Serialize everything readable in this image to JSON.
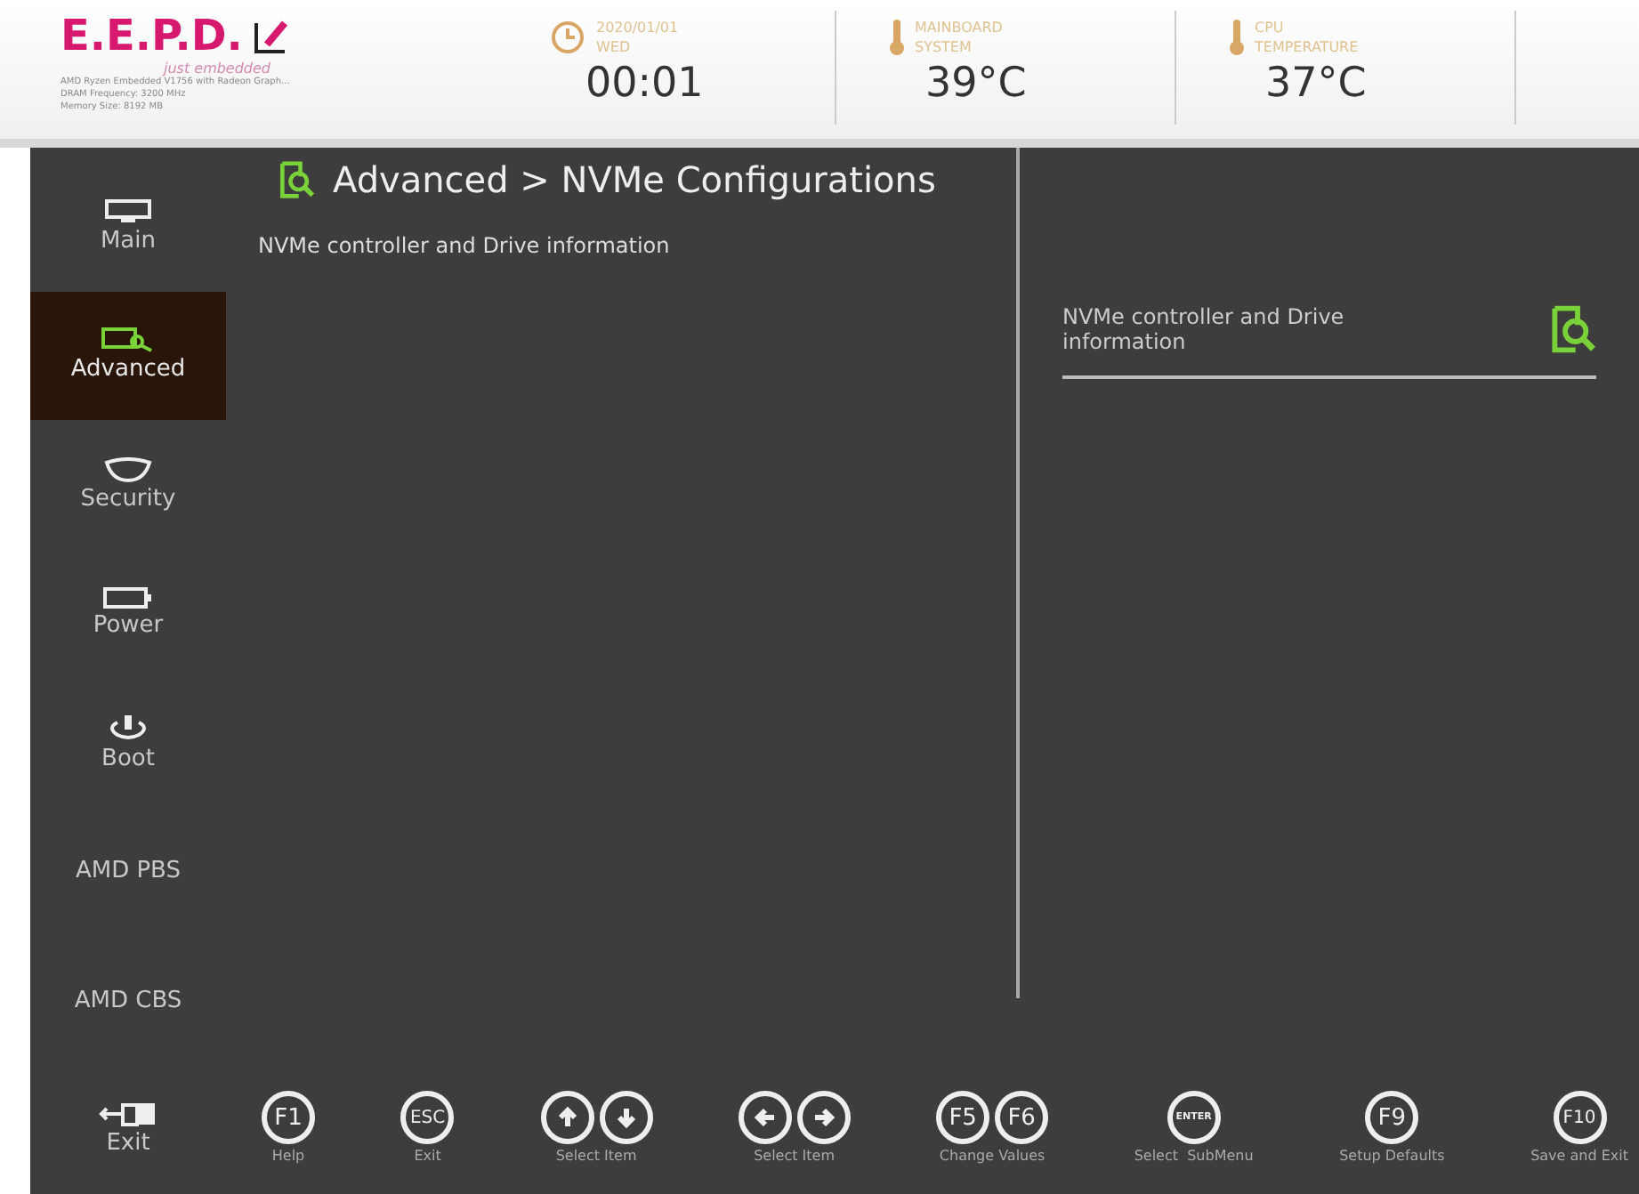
{
  "header": {
    "logo": "E.E.P.D.",
    "tagline": "just embedded",
    "system_info": [
      "AMD Ryzen Embedded V1756 with Radeon Graph...",
      "DRAM Frequency: 3200 MHz",
      "Memory Size: 8192 MB"
    ],
    "widgets": [
      {
        "kind": "clock",
        "caption": [
          "2020/01/01",
          "WED"
        ],
        "value": "00:01"
      },
      {
        "kind": "thermometer",
        "caption": [
          "MAINBOARD",
          "SYSTEM"
        ],
        "value": "39°C"
      },
      {
        "kind": "thermometer",
        "caption": [
          "CPU",
          "TEMPERATURE"
        ],
        "value": "37°C"
      }
    ]
  },
  "sidebar": {
    "items": [
      {
        "label": "Main",
        "kind": "monitor",
        "selected": false
      },
      {
        "label": "Advanced",
        "kind": "advanced",
        "selected": true
      },
      {
        "label": "Security",
        "kind": "shield",
        "selected": false
      },
      {
        "label": "Power",
        "kind": "battery",
        "selected": false
      },
      {
        "label": "Boot",
        "kind": "power",
        "selected": false
      },
      {
        "label": "AMD PBS",
        "kind": "none",
        "selected": false
      },
      {
        "label": "AMD CBS",
        "kind": "none",
        "selected": false
      },
      {
        "label": "Exit",
        "kind": "exit",
        "selected": false
      }
    ]
  },
  "breadcrumb": "Advanced > NVMe Configurations",
  "items": [
    "NVMe controller and Drive information"
  ],
  "help": {
    "text": "NVMe controller and Drive information"
  },
  "footer": {
    "keys": [
      {
        "keys": [
          {
            "kind": "text",
            "label": "F1"
          }
        ],
        "label": "Help"
      },
      {
        "keys": [
          {
            "kind": "text",
            "label": "ESC"
          }
        ],
        "label": "Exit"
      },
      {
        "keys": [
          {
            "kind": "up"
          },
          {
            "kind": "down"
          }
        ],
        "label": "Select Item"
      },
      {
        "keys": [
          {
            "kind": "left"
          },
          {
            "kind": "right"
          }
        ],
        "label": "Select Item"
      },
      {
        "keys": [
          {
            "kind": "text",
            "label": "F5"
          },
          {
            "kind": "text",
            "label": "F6"
          }
        ],
        "label": "Change Values"
      },
      {
        "keys": [
          {
            "kind": "text",
            "label": "ENTER"
          }
        ],
        "label": "Select  SubMenu"
      },
      {
        "keys": [
          {
            "kind": "text",
            "label": "F9"
          }
        ],
        "label": "Setup Defaults"
      },
      {
        "keys": [
          {
            "kind": "text",
            "label": "F10"
          }
        ],
        "label": "Save and Exit"
      }
    ]
  }
}
